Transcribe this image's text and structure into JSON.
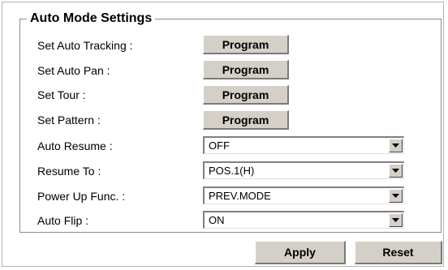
{
  "section": {
    "title": "Auto Mode Settings"
  },
  "program_rows": [
    {
      "label": "Set Auto Tracking :",
      "button": "Program"
    },
    {
      "label": "Set Auto Pan  :",
      "button": "Program"
    },
    {
      "label": "Set Tour :",
      "button": "Program"
    },
    {
      "label": "Set Pattern  :",
      "button": "Program"
    }
  ],
  "select_rows": [
    {
      "label": "Auto Resume :",
      "value": "OFF"
    },
    {
      "label": "Resume To :",
      "value": "POS.1(H)"
    },
    {
      "label": "Power Up Func. :",
      "value": "PREV.MODE"
    },
    {
      "label": "Auto Flip :",
      "value": "ON"
    }
  ],
  "actions": {
    "apply": "Apply",
    "reset": "Reset"
  },
  "icons": {
    "dropdown": "chevron-down-icon"
  }
}
